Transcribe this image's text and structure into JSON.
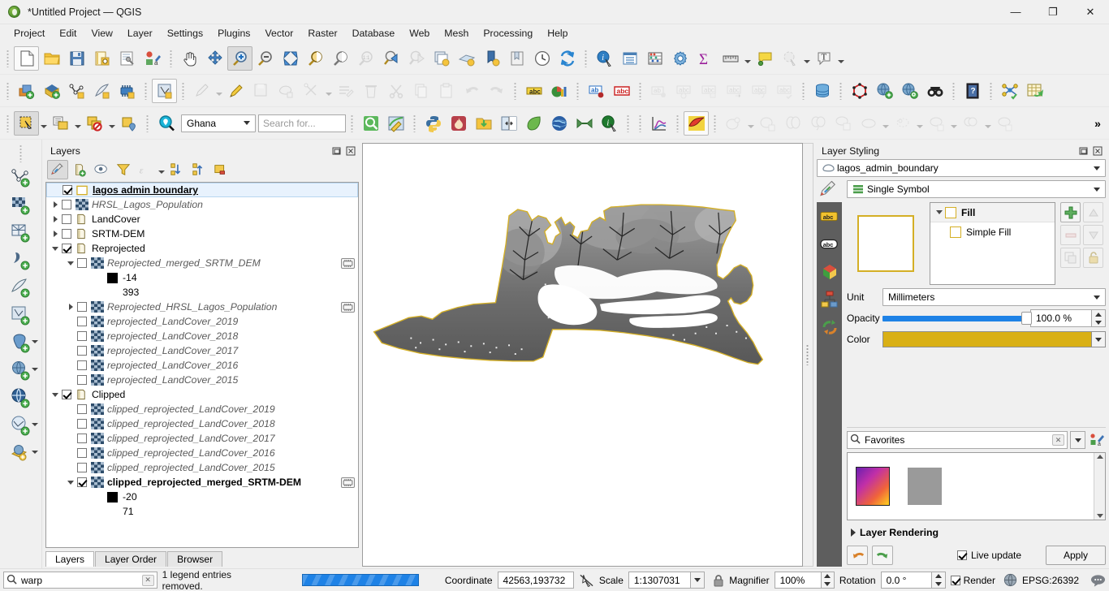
{
  "window": {
    "title": "*Untitled Project — QGIS",
    "app_icon": "qgis-logo-icon",
    "minimize": "—",
    "maximize": "❐",
    "close": "✕"
  },
  "menubar": [
    {
      "label": "Project"
    },
    {
      "label": "Edit"
    },
    {
      "label": "View"
    },
    {
      "label": "Layer"
    },
    {
      "label": "Settings"
    },
    {
      "label": "Plugins"
    },
    {
      "label": "Vector"
    },
    {
      "label": "Raster"
    },
    {
      "label": "Database"
    },
    {
      "label": "Web"
    },
    {
      "label": "Mesh"
    },
    {
      "label": "Processing"
    },
    {
      "label": "Help"
    }
  ],
  "toolbar_project": {
    "new_project": "new-project-icon",
    "open_project": "open-project-icon",
    "save_project": "save-project-icon",
    "save_project_as": "save-project-as-icon",
    "new_print_layout": "new-print-layout-icon",
    "style_manager": "style-manager-icon",
    "pan_map": "pan-map-icon",
    "pan_to_selection": "pan-to-selection-icon",
    "zoom_in": "zoom-in-icon",
    "zoom_out": "zoom-out-icon",
    "zoom_full": "zoom-full-icon",
    "zoom_to_selection": "zoom-to-selection-icon",
    "zoom_to_layer": "zoom-to-layer-icon",
    "zoom_native": "zoom-native-resolution-icon",
    "zoom_last": "zoom-last-icon",
    "zoom_next": "zoom-next-icon",
    "new_map_view": "new-map-view-icon",
    "new_3d_map_view": "new-3d-map-view-icon",
    "refresh_view": "new-bookmark-icon",
    "show_bookmarks": "show-bookmarks-icon",
    "temporal_controller": "temporal-controller-icon",
    "refresh": "refresh-icon",
    "identify_features": "identify-features-icon",
    "attribute_table": "open-attribute-table-icon",
    "field_calculator": "field-calculator-icon",
    "options": "options-gear-icon",
    "statistical_summary": "statistical-summary-icon",
    "measure_line": "measure-line-icon",
    "map_tips": "map-tips-icon",
    "deselect": "deselect-icon",
    "text_annotation": "text-annotation-icon"
  },
  "toolbar_digitizing": {
    "add_vector_layer": "add-vector-layer-icon",
    "add_raster_layer": "add-raster-layer-icon",
    "add_mesh_layer": "add-mesh-layer-icon",
    "add_delimited_text": "add-delimited-text-layer-icon",
    "add_postgis": "add-postgis-layer-icon",
    "new_shapefile": "new-shapefile-layer-icon",
    "current_edits": "current-edits-icon",
    "toggle_editing": "toggle-editing-icon",
    "save_layer_edits": "save-layer-edits-icon",
    "add_polygon_feature": "add-polygon-feature-icon",
    "vertex_tool": "vertex-tool-icon",
    "modify_attributes": "modify-attributes-icon",
    "delete_selected": "delete-selected-icon",
    "cut_features": "cut-features-icon",
    "copy_features": "copy-features-icon",
    "paste_features": "paste-features-icon",
    "undo": "undo-icon",
    "redo": "redo-icon",
    "label_layer": "label-layer-icon",
    "diagram_layer": "diagram-layer-icon",
    "pin_labels": "pin-labels-icon",
    "highlight_labels": "highlight-labels-icon",
    "move_label": "move-label-icon",
    "rotate_label": "rotate-label-icon",
    "change_label": "change-label-icon",
    "db_manager": "db-manager-icon",
    "topology_checker": "topology-checker-icon",
    "metasearch": "metasearch-icon",
    "qgis_browser": "qgis-browser-icon",
    "search_qms": "search-qms-icon",
    "help": "help-icon",
    "plugin_manager": "plugin-manager-icon",
    "raster_calculator": "raster-calculator-icon"
  },
  "toolbar_selection": {
    "select_features": "select-features-icon",
    "select_by_value": "select-by-value-icon",
    "deselect_features": "deselect-features-icon",
    "select_by_location": "select-by-location-icon",
    "locate_search_icon": "locate-search-icon",
    "country_filter_value": "Ghana",
    "search_placeholder": "Search for...",
    "quick_osm": "quick-osm-icon",
    "qgis2web": "qgis2web-icon",
    "python_console": "python-console-icon",
    "heatmap": "heatmap-icon",
    "load_data": "load-data-icon",
    "swipe_tool": "swipe-tool-icon",
    "leaflet": "leaflet-icon",
    "globe": "globe-icon",
    "mmqgis": "mmqgis-icon",
    "info": "info-icon",
    "profile_tool": "profile-tool-icon",
    "georeferencer": "georeferencer-icon",
    "geoprocessing_buffer": "geoprocessing-buffer-icon",
    "geoprocessing_clip": "geoprocessing-clip-icon",
    "geoprocessing_intersect": "geoprocessing-intersect-icon",
    "geoprocessing_union": "geoprocessing-union-icon",
    "geoprocessing_dissolve": "geoprocessing-dissolve-icon",
    "geoprocessing_difference": "geoprocessing-difference-icon",
    "geoprocessing_symdiff": "geoprocessing-symmetrical-difference-icon",
    "geoprocessing_convexhull": "geoprocessing-convex-hull-icon",
    "overflow": "»"
  },
  "left_toolbar": [
    {
      "name": "add-vector-layer-icon"
    },
    {
      "name": "add-raster-layer-icon"
    },
    {
      "name": "add-mesh-layer-icon"
    },
    {
      "name": "add-delimited-text-layer-icon"
    },
    {
      "name": "add-spatialite-layer-icon"
    },
    {
      "name": "add-virtual-layer-icon"
    },
    {
      "name": "add-postgis-layer-icon",
      "caret": true
    },
    {
      "name": "add-wms-layer-icon",
      "caret": true
    },
    {
      "name": "add-wfs-layer-icon"
    },
    {
      "name": "add-vector-tile-layer-icon",
      "caret": true
    },
    {
      "name": "add-point-cloud-layer-icon",
      "caret": true
    }
  ],
  "layers_panel": {
    "title": "Layers",
    "undock_icon": "undock-icon",
    "close_icon": "close-icon",
    "toolbar": [
      {
        "name": "open-layer-styling-panel-button",
        "active": true
      },
      {
        "name": "add-group-button"
      },
      {
        "name": "manage-map-themes-button",
        "caret": true
      },
      {
        "name": "filter-legend-button"
      },
      {
        "name": "filter-legend-by-expression-button",
        "caret": true
      },
      {
        "name": "expand-all-button"
      },
      {
        "name": "collapse-all-button"
      },
      {
        "name": "remove-layer-button"
      }
    ],
    "tree": [
      {
        "indent": 0,
        "expander": "none",
        "checkbox": "checked",
        "icon": "polygon-layer-icon",
        "label": "lagos admin boundary",
        "style": "sel",
        "selected": true
      },
      {
        "indent": 0,
        "expander": "right",
        "checkbox": "unchecked",
        "icon": "raster-layer-icon",
        "label": "HRSL_Lagos_Population",
        "style": "it"
      },
      {
        "indent": 0,
        "expander": "right",
        "checkbox": "unchecked",
        "icon": "group-icon",
        "label": "LandCover",
        "style": "normal"
      },
      {
        "indent": 0,
        "expander": "right",
        "checkbox": "unchecked",
        "icon": "group-icon",
        "label": "SRTM-DEM",
        "style": "normal"
      },
      {
        "indent": 0,
        "expander": "down",
        "checkbox": "checked",
        "icon": "group-icon",
        "label": "Reprojected",
        "style": "normal"
      },
      {
        "indent": 1,
        "expander": "down",
        "checkbox": "unchecked",
        "icon": "raster-layer-icon",
        "label": "Reprojected_merged_SRTM_DEM",
        "style": "it",
        "trailing": "raster-chip"
      },
      {
        "indent": 2,
        "expander": "none",
        "checkbox": "none",
        "icon": "swatch-black",
        "label": "-14",
        "style": "normal"
      },
      {
        "indent": 2,
        "expander": "none",
        "checkbox": "none",
        "icon": "none",
        "label": "393",
        "style": "normal"
      },
      {
        "indent": 1,
        "expander": "right",
        "checkbox": "unchecked",
        "icon": "raster-layer-icon",
        "label": "Reprojected_HRSL_Lagos_Population",
        "style": "it",
        "trailing": "raster-chip"
      },
      {
        "indent": 1,
        "expander": "none",
        "checkbox": "unchecked",
        "icon": "raster-layer-icon",
        "label": "reprojected_LandCover_2019",
        "style": "it"
      },
      {
        "indent": 1,
        "expander": "none",
        "checkbox": "unchecked",
        "icon": "raster-layer-icon",
        "label": "reprojected_LandCover_2018",
        "style": "it"
      },
      {
        "indent": 1,
        "expander": "none",
        "checkbox": "unchecked",
        "icon": "raster-layer-icon",
        "label": "reprojected_LandCover_2017",
        "style": "it"
      },
      {
        "indent": 1,
        "expander": "none",
        "checkbox": "unchecked",
        "icon": "raster-layer-icon",
        "label": "reprojected_LandCover_2016",
        "style": "it"
      },
      {
        "indent": 1,
        "expander": "none",
        "checkbox": "unchecked",
        "icon": "raster-layer-icon",
        "label": "reprojected_LandCover_2015",
        "style": "it"
      },
      {
        "indent": 0,
        "expander": "down",
        "checkbox": "checked",
        "icon": "group-icon",
        "label": "Clipped",
        "style": "normal"
      },
      {
        "indent": 1,
        "expander": "none",
        "checkbox": "unchecked",
        "icon": "raster-layer-icon",
        "label": "clipped_reprojected_LandCover_2019",
        "style": "it"
      },
      {
        "indent": 1,
        "expander": "none",
        "checkbox": "unchecked",
        "icon": "raster-layer-icon",
        "label": "clipped_reprojected_LandCover_2018",
        "style": "it"
      },
      {
        "indent": 1,
        "expander": "none",
        "checkbox": "unchecked",
        "icon": "raster-layer-icon",
        "label": "clipped_reprojected_LandCover_2017",
        "style": "it"
      },
      {
        "indent": 1,
        "expander": "none",
        "checkbox": "unchecked",
        "icon": "raster-layer-icon",
        "label": "clipped_reprojected_LandCover_2016",
        "style": "it"
      },
      {
        "indent": 1,
        "expander": "none",
        "checkbox": "unchecked",
        "icon": "raster-layer-icon",
        "label": "clipped_reprojected_LandCover_2015",
        "style": "it"
      },
      {
        "indent": 1,
        "expander": "down",
        "checkbox": "checked",
        "icon": "raster-layer-icon",
        "label": "clipped_reprojected_merged_SRTM-DEM",
        "style": "bold",
        "trailing": "raster-chip"
      },
      {
        "indent": 2,
        "expander": "none",
        "checkbox": "none",
        "icon": "swatch-black",
        "label": "-20",
        "style": "normal"
      },
      {
        "indent": 2,
        "expander": "none",
        "checkbox": "none",
        "icon": "none",
        "label": "71",
        "style": "normal"
      }
    ],
    "tabs": [
      {
        "label": "Layers",
        "active": true
      },
      {
        "label": "Layer Order",
        "active": false
      },
      {
        "label": "Browser",
        "active": false
      }
    ]
  },
  "map": {
    "name": "map-canvas",
    "boundary_color": "#d4af25"
  },
  "style_panel": {
    "title": "Layer Styling",
    "undock_icon": "undock-icon",
    "close_icon": "close-icon",
    "layer_combo_value": "lagos_admin_boundary",
    "layer_combo_icon": "polygon-layer-icon",
    "renderer_combo_value": "Single Symbol",
    "renderer_combo_icon": "single-symbol-icon",
    "vtabs": [
      {
        "name": "labels-tab-icon"
      },
      {
        "name": "masks-tab-icon"
      },
      {
        "name": "3d-view-tab-icon"
      },
      {
        "name": "diagrams-tab-icon"
      },
      {
        "name": "history-tab-icon"
      }
    ],
    "symbol_tree": {
      "root_label": "Fill",
      "child_label": "Simple Fill"
    },
    "symbol_buttons": [
      {
        "name": "add-symbol-layer-button",
        "glyph": "+",
        "enabled": true
      },
      {
        "name": "move-symbol-up-button",
        "glyph": "▲",
        "enabled": false
      },
      {
        "name": "remove-symbol-layer-button",
        "glyph": "–",
        "enabled": false
      },
      {
        "name": "move-symbol-down-button",
        "glyph": "▼",
        "enabled": false
      },
      {
        "name": "duplicate-symbol-layer-button",
        "glyph": "⧉",
        "enabled": false
      },
      {
        "name": "lock-symbol-color-button",
        "glyph": "🔒",
        "enabled": false
      }
    ],
    "unit_label": "Unit",
    "unit_value": "Millimeters",
    "opacity_label": "Opacity",
    "opacity_value": "100.0 %",
    "color_label": "Color",
    "color_value": "#d9b016",
    "favorites_search_placeholder": "Favorites",
    "favorites_search_icon": "search-icon",
    "favorites_clear_icon": "clear-icon",
    "favorites_dropdown_icon": "chevron-down-icon",
    "style_manager_icon": "style-manager-icon",
    "gallery": [
      {
        "name": "gradient-ramp-swatch"
      },
      {
        "name": "gray-fill-swatch"
      }
    ],
    "layer_rendering_label": "Layer Rendering",
    "undo_icon": "undo-icon",
    "redo_icon": "redo-icon",
    "live_update_label": "Live update",
    "live_update_checked": true,
    "apply_label": "Apply"
  },
  "statusbar": {
    "search_value": "warp",
    "search_icon": "search-icon",
    "clear_icon": "clear-icon",
    "message": "1 legend entries removed.",
    "progress_percent": 100,
    "coordinate_label": "Coordinate",
    "coordinate_value": "42563,193732",
    "toggle_extents_icon": "toggle-extents-icon",
    "scale_label": "Scale",
    "scale_value": "1:1307031",
    "scale_dropdown_icon": "chevron-down-icon",
    "lock_scale_icon": "lock-icon",
    "magnifier_label": "Magnifier",
    "magnifier_value": "100%",
    "rotation_label": "Rotation",
    "rotation_value": "0.0 °",
    "render_label": "Render",
    "render_checked": true,
    "crs_icon": "globe-icon",
    "crs_value": "EPSG:26392",
    "messages_icon": "messages-icon"
  }
}
